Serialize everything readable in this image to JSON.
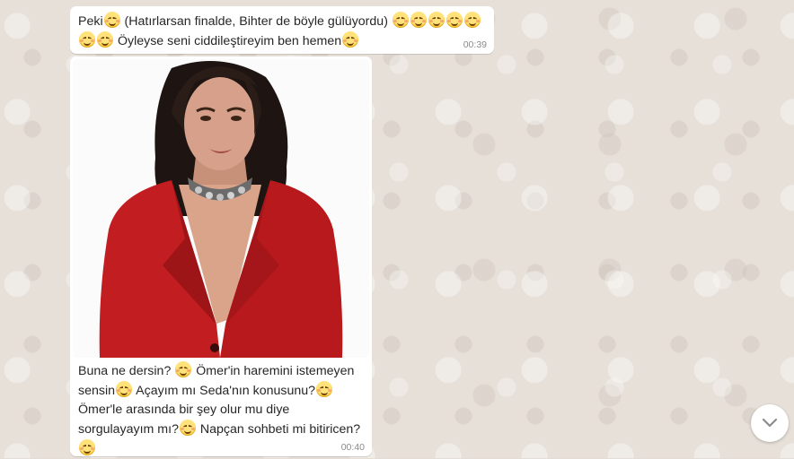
{
  "messages": [
    {
      "parts": [
        "Peki",
        ":smile:",
        " (Hatırlarsan finalde, Bihter de böyle gülüyordu) ",
        ":smile:",
        ":smile:",
        ":smile:",
        ":smile:",
        ":smile:",
        ":smile:",
        ":smile:",
        " Öyleyse seni ciddileştireyim ben hemen",
        ":smile:"
      ],
      "time": "00:39"
    },
    {
      "has_image": true,
      "image_alt": "photo of a woman in a red blazer",
      "parts": [
        "Buna ne dersin? ",
        ":smile:",
        " Ömer'in haremini istemeyen sensin",
        ":smile:",
        " Açayım mı Seda'nın konusunu?",
        ":smile:",
        " Ömer'le arasında bir şey olur mu diye sorgulayayım mı?",
        ":smile:",
        " Napçan sohbeti mi bitiricen? ",
        ":smile:"
      ],
      "time": "00:40"
    }
  ],
  "scroll_down": {
    "icon": "chevron-down-icon"
  },
  "colors": {
    "chat_background": "#e6e0d8",
    "bubble": "#ffffff",
    "timestamp": "#8a8a8a"
  }
}
